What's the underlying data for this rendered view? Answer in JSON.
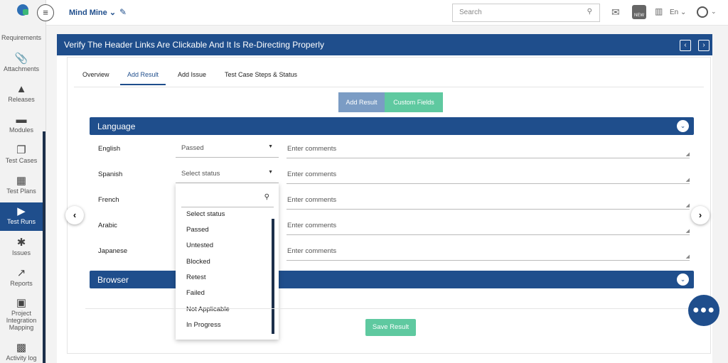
{
  "sidebar": {
    "items": [
      {
        "label": "Requirements",
        "icon": "requirements-icon"
      },
      {
        "label": "Attachments",
        "icon": "paperclip-icon"
      },
      {
        "label": "Releases",
        "icon": "road-icon"
      },
      {
        "label": "Modules",
        "icon": "archive-icon"
      },
      {
        "label": "Test Cases",
        "icon": "copy-icon"
      },
      {
        "label": "Test Plans",
        "icon": "swatch-icon"
      },
      {
        "label": "Test Runs",
        "icon": "play-icon",
        "active": true
      },
      {
        "label": "Issues",
        "icon": "bug-icon"
      },
      {
        "label": "Reports",
        "icon": "chart-icon"
      },
      {
        "label": "Project Integration Mapping",
        "icon": "integration-icon"
      },
      {
        "label": "Activity log",
        "icon": "box-icon"
      }
    ]
  },
  "header": {
    "project": "Mind Mine",
    "search_placeholder": "Search",
    "language": "En",
    "new_badge": "NEW"
  },
  "page": {
    "title": "Verify The Header Links Are Clickable And It Is Re-Directing Properly"
  },
  "tabs": [
    "Overview",
    "Add Result",
    "Add Issue",
    "Test Case Steps & Status"
  ],
  "active_tab": "Add Result",
  "segments": {
    "add_result": "Add Result",
    "custom_fields": "Custom Fields"
  },
  "sections": {
    "language": "Language",
    "browser": "Browser"
  },
  "rows": [
    {
      "label": "English",
      "status": "Passed",
      "comment_placeholder": "Enter comments"
    },
    {
      "label": "Spanish",
      "status": "Select status",
      "comment_placeholder": "Enter comments"
    },
    {
      "label": "French",
      "comment_placeholder": "Enter comments"
    },
    {
      "label": "Arabic",
      "comment_placeholder": "Enter comments"
    },
    {
      "label": "Japanese",
      "comment_placeholder": "Enter comments"
    }
  ],
  "dropdown": {
    "options": [
      "Select status",
      "Passed",
      "Untested",
      "Blocked",
      "Retest",
      "Failed",
      "Not Applicable",
      "In Progress"
    ]
  },
  "save_label": "Save Result",
  "colors": {
    "primary": "#1f4e8c",
    "success": "#5fc9a0",
    "segment_inactive": "#7b9cc4"
  }
}
